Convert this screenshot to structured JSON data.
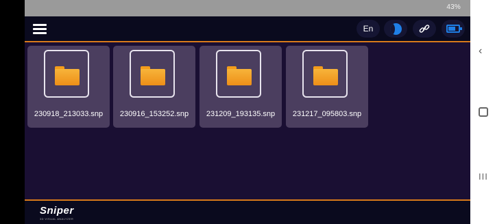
{
  "status_bar": {
    "text": "43%"
  },
  "topbar": {
    "language": "En"
  },
  "files": [
    {
      "name": "230918_213033.snp"
    },
    {
      "name": "230916_153252.snp"
    },
    {
      "name": "231209_193135.snp"
    },
    {
      "name": "231217_095803.snp"
    }
  ],
  "brand": {
    "logo": "Sniper",
    "tagline": "3D VISUAL ANALYZER"
  },
  "nav": {
    "back": "‹",
    "recent": "III"
  },
  "icons": {
    "menu": "hamburger-menu-icon",
    "theme": "half-moon-icon",
    "link": "link-icon",
    "battery": "battery-icon",
    "folder": "folder-icon"
  },
  "colors": {
    "accent": "#d97a1a",
    "background": "#1a0f33",
    "tile": "#4b3e5f",
    "icon_blue": "#1f7fe6",
    "folder": "#f39c1a"
  }
}
